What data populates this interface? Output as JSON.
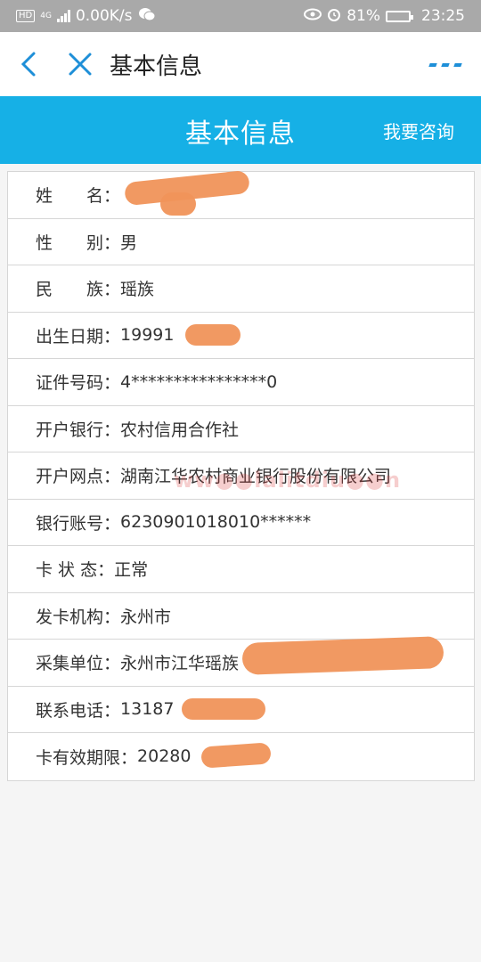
{
  "status_bar": {
    "network_type": "4G",
    "speed": "0.00K/s",
    "battery_percent": "81%",
    "battery_level": 0.81,
    "time": "23:25",
    "hd_label": "HD"
  },
  "nav": {
    "title": "基本信息"
  },
  "header": {
    "title": "基本信息",
    "consult_label": "我要咨询",
    "color": "#16b0e6"
  },
  "rows": [
    {
      "label": "姓　　名：",
      "value": ""
    },
    {
      "label": "性　　别：",
      "value": "男"
    },
    {
      "label": "民　　族：",
      "value": "瑶族"
    },
    {
      "label": "出生日期：",
      "value": "19991"
    },
    {
      "label": "证件号码：",
      "value": "4****************0"
    },
    {
      "label": "开户银行：",
      "value": "农村信用合作社"
    },
    {
      "label": "开户网点：",
      "value": "湖南江华农村商业银行股份有限公司"
    },
    {
      "label": "银行账号：",
      "value": "6230901018010******"
    },
    {
      "label": "卡 状 态：",
      "value": "正常"
    },
    {
      "label": "发卡机构：",
      "value": "永州市"
    },
    {
      "label": "采集单位：",
      "value": "永州市江华瑶族"
    },
    {
      "label": "联系电话：",
      "value": "13187"
    },
    {
      "label": "卡有效期限：",
      "value": "20280"
    }
  ]
}
